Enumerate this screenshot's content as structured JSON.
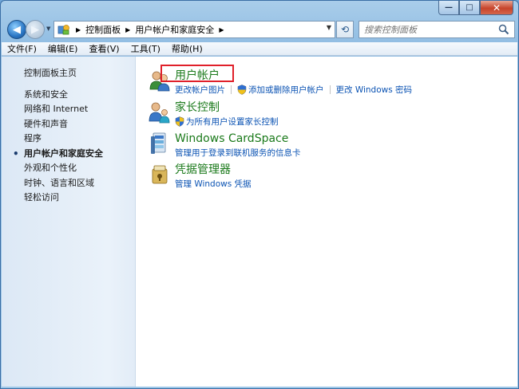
{
  "window": {
    "caption_minimize": "—",
    "caption_maximize": "□",
    "caption_close": "✕"
  },
  "navbar": {
    "back_label": "◀",
    "forward_label": "▶",
    "breadcrumbs": [
      "控制面板",
      "用户帐户和家庭安全"
    ],
    "search_placeholder": "搜索控制面板"
  },
  "menubar": {
    "items": [
      "文件(F)",
      "编辑(E)",
      "查看(V)",
      "工具(T)",
      "帮助(H)"
    ]
  },
  "sidebar": {
    "home": "控制面板主页",
    "items": [
      "系统和安全",
      "网络和 Internet",
      "硬件和声音",
      "程序",
      "用户帐户和家庭安全",
      "外观和个性化",
      "时钟、语言和区域",
      "轻松访问"
    ],
    "active_index": 4
  },
  "categories": [
    {
      "title": "用户帐户",
      "icon": "users-icon",
      "links": [
        "更改帐户图片",
        "添加或删除用户帐户",
        "更改 Windows 密码"
      ],
      "shield_link_index": 1
    },
    {
      "title": "家长控制",
      "icon": "parental-controls-icon",
      "links": [
        "为所有用户设置家长控制"
      ],
      "shield_link_index": 0
    },
    {
      "title": "Windows CardSpace",
      "icon": "cardspace-icon",
      "links": [
        "管理用于登录到联机服务的信息卡"
      ]
    },
    {
      "title": "凭据管理器",
      "icon": "credential-manager-icon",
      "links": [
        "管理 Windows 凭据"
      ]
    }
  ],
  "colors": {
    "category_title": "#1b7a1b",
    "link": "#0b53b3",
    "highlight_box": "#e0202a"
  }
}
